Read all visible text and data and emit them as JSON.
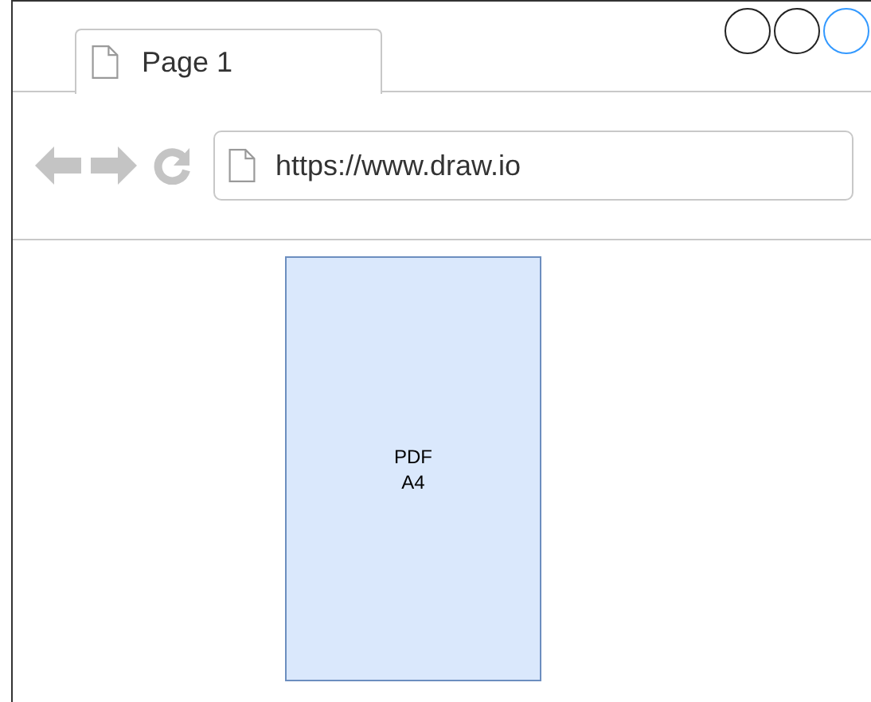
{
  "tabs": [
    {
      "label": "Page 1",
      "selected": true
    }
  ],
  "window_buttons": [
    {
      "selected": false
    },
    {
      "selected": false
    },
    {
      "selected": true
    }
  ],
  "address_bar": {
    "value": "https://www.draw.io"
  },
  "page": {
    "lines": [
      "PDF",
      "A4"
    ]
  }
}
